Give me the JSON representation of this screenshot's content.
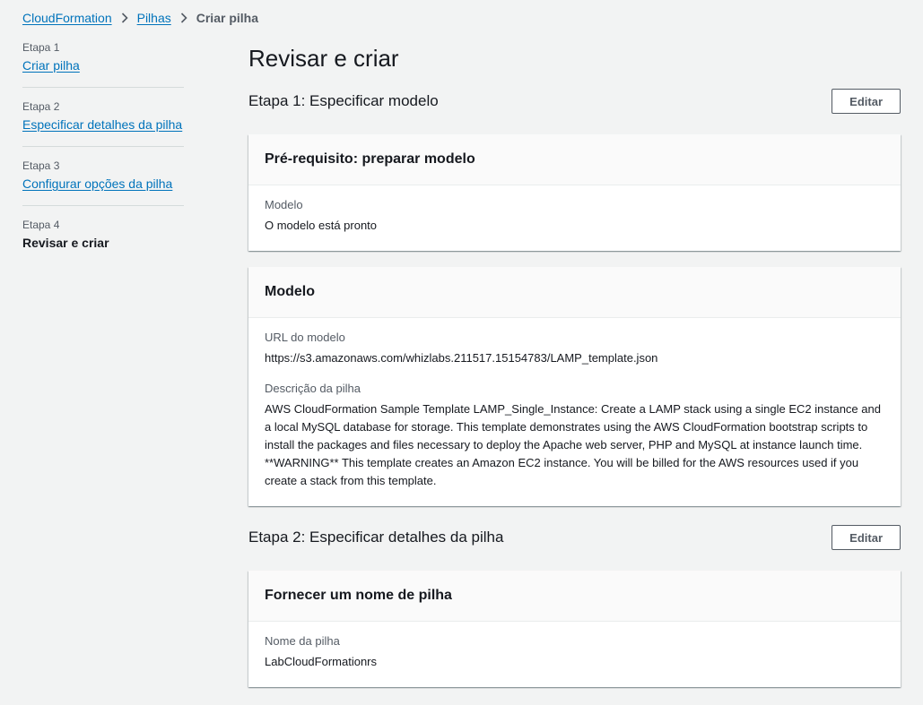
{
  "breadcrumb": {
    "items": [
      "CloudFormation",
      "Pilhas"
    ],
    "current": "Criar pilha"
  },
  "steps": [
    {
      "num": "Etapa 1",
      "label": "Criar pilha"
    },
    {
      "num": "Etapa 2",
      "label": "Especificar detalhes da pilha"
    },
    {
      "num": "Etapa 3",
      "label": "Configurar opções da pilha"
    },
    {
      "num": "Etapa 4",
      "label": "Revisar e criar"
    }
  ],
  "main": {
    "title": "Revisar e criar",
    "edit_label": "Editar",
    "section1": {
      "title": "Etapa 1: Especificar modelo",
      "card1": {
        "header": "Pré-requisito: preparar modelo",
        "label": "Modelo",
        "value": "O modelo está pronto"
      },
      "card2": {
        "header": "Modelo",
        "url_label": "URL do modelo",
        "url_value": "https://s3.amazonaws.com/whizlabs.211517.15154783/LAMP_template.json",
        "desc_label": "Descrição da pilha",
        "desc_value": "AWS CloudFormation Sample Template LAMP_Single_Instance: Create a LAMP stack using a single EC2 instance and a local MySQL database for storage. This template demonstrates using the AWS CloudFormation bootstrap scripts to install the packages and files necessary to deploy the Apache web server, PHP and MySQL at instance launch time. **WARNING** This template creates an Amazon EC2 instance. You will be billed for the AWS resources used if you create a stack from this template."
      }
    },
    "section2": {
      "title": "Etapa 2: Especificar detalhes da pilha",
      "card1": {
        "header": "Fornecer um nome de pilha",
        "label": "Nome da pilha",
        "value": "LabCloudFormationrs"
      }
    }
  },
  "colors": {
    "link": "#0073bb",
    "background": "#f2f3f3",
    "text": "#16191f",
    "muted": "#545b64"
  }
}
